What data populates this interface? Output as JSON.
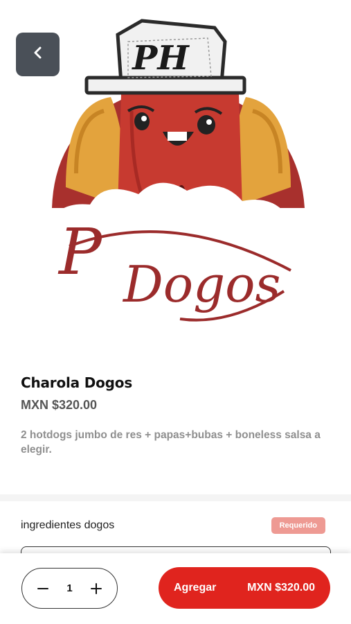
{
  "header": {
    "back_icon": "chevron-left-icon",
    "logo_text": "P Dogos",
    "hat_monogram": "PH"
  },
  "product": {
    "name": "Charola Dogos",
    "price": "MXN $320.00",
    "description": "2 hotdogs jumbo de res + papas+bubas + boneless salsa a elegir."
  },
  "options": {
    "group_label": "ingredientes dogos",
    "required_badge": "Requerido"
  },
  "footer": {
    "quantity": "1",
    "minus_icon": "minus-icon",
    "plus_icon": "plus-icon",
    "add_label": "Agregar",
    "add_price": "MXN $320.00"
  },
  "colors": {
    "accent": "#e0241e",
    "back_button": "#4a5058",
    "badge": "#ee9a93",
    "logo_red": "#9b2b2b"
  }
}
